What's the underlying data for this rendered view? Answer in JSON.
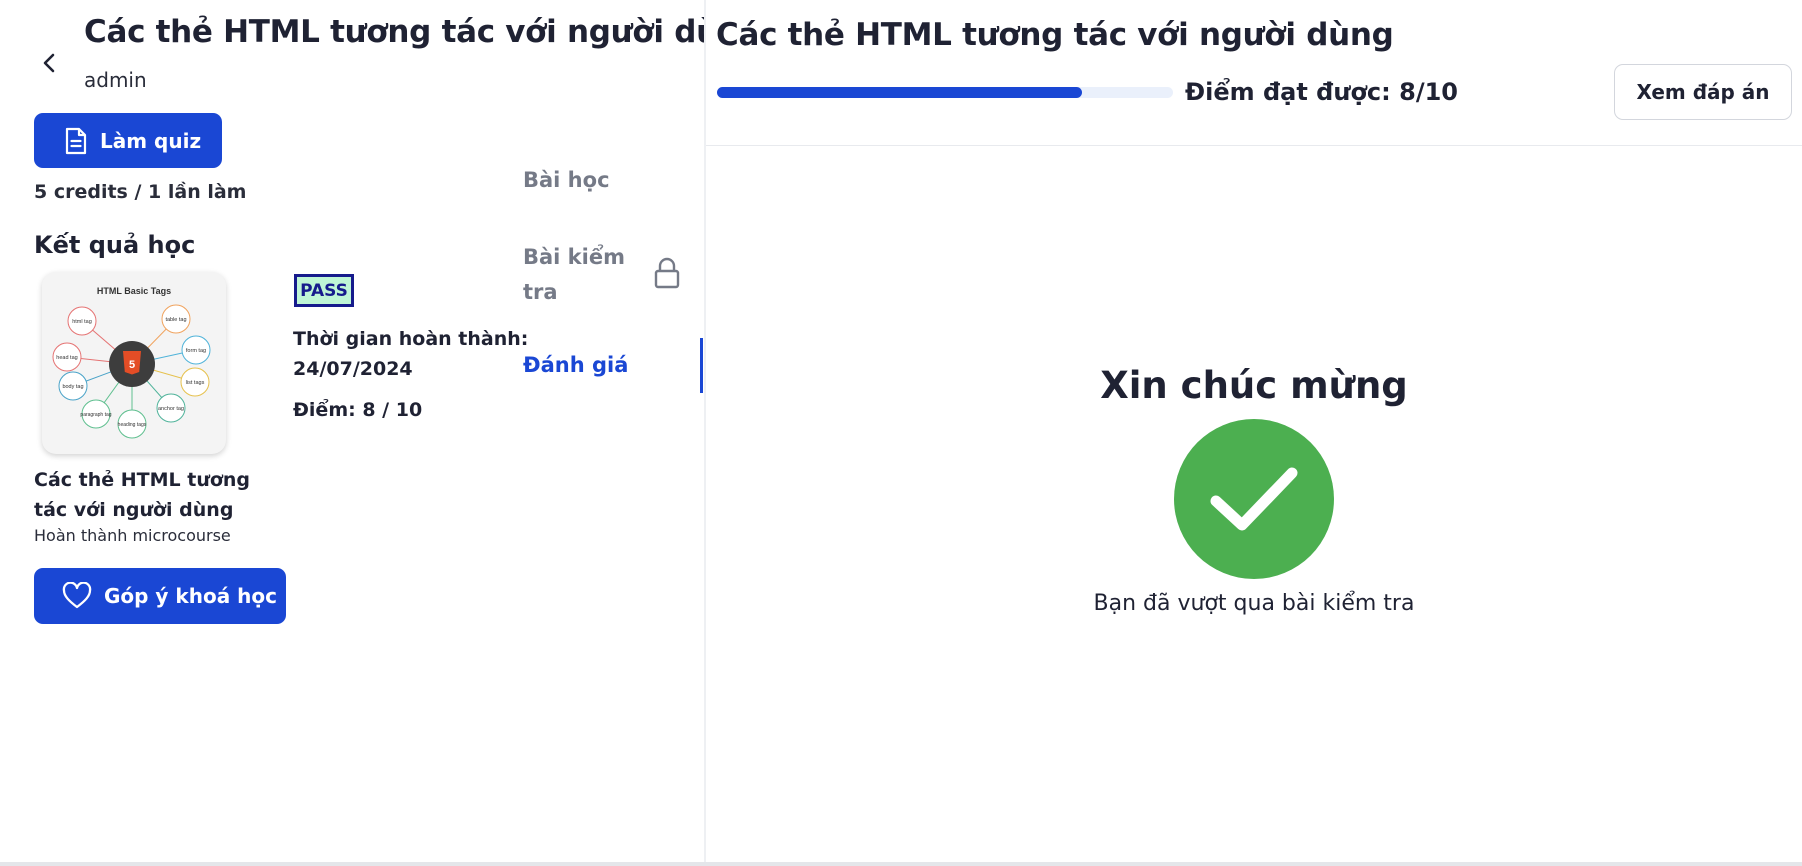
{
  "course": {
    "title": "Các thẻ HTML tương tác với người dùng",
    "author": "admin"
  },
  "quiz_button": {
    "label": "Làm quiz",
    "icon": "document-icon"
  },
  "credits_text": "5 credits / 1 lần làm",
  "results": {
    "heading": "Kết quả học",
    "item_title": "Các thẻ HTML tương tác với người dùng",
    "item_subtitle": "Hoàn thành microcourse",
    "thumbnail": {
      "title": "HTML Basic Tags",
      "tags": [
        "html tag",
        "table tag",
        "head tag",
        "form tag",
        "body tag",
        "list tags",
        "paragraph tag",
        "heading tags",
        "anchor tag"
      ]
    },
    "status_badge": "PASS",
    "completion_label": "Thời gian hoàn thành:",
    "completion_date": "24/07/2024",
    "score_label": "Điểm: 8 / 10"
  },
  "nav": {
    "lesson": "Bài học",
    "test": "Bài kiểm tra",
    "evaluation": "Đánh giá",
    "active": "evaluation"
  },
  "feedback_button": {
    "label": "Góp ý khoá học",
    "icon": "heart-icon"
  },
  "quiz_result": {
    "title": "Các thẻ HTML tương tác với người dùng",
    "progress_fraction": 0.8,
    "score_text": "Điểm đạt được: 8/10",
    "view_answers_label": "Xem đáp án",
    "congrats": "Xin chúc mừng",
    "passed_message": "Bạn đã vượt qua bài kiểm tra"
  },
  "colors": {
    "accent": "#1a47d4",
    "success": "#4caf50",
    "pass_badge_bg": "#bff6d6",
    "pass_badge_border": "#161b8c",
    "muted_text": "#757a87"
  }
}
